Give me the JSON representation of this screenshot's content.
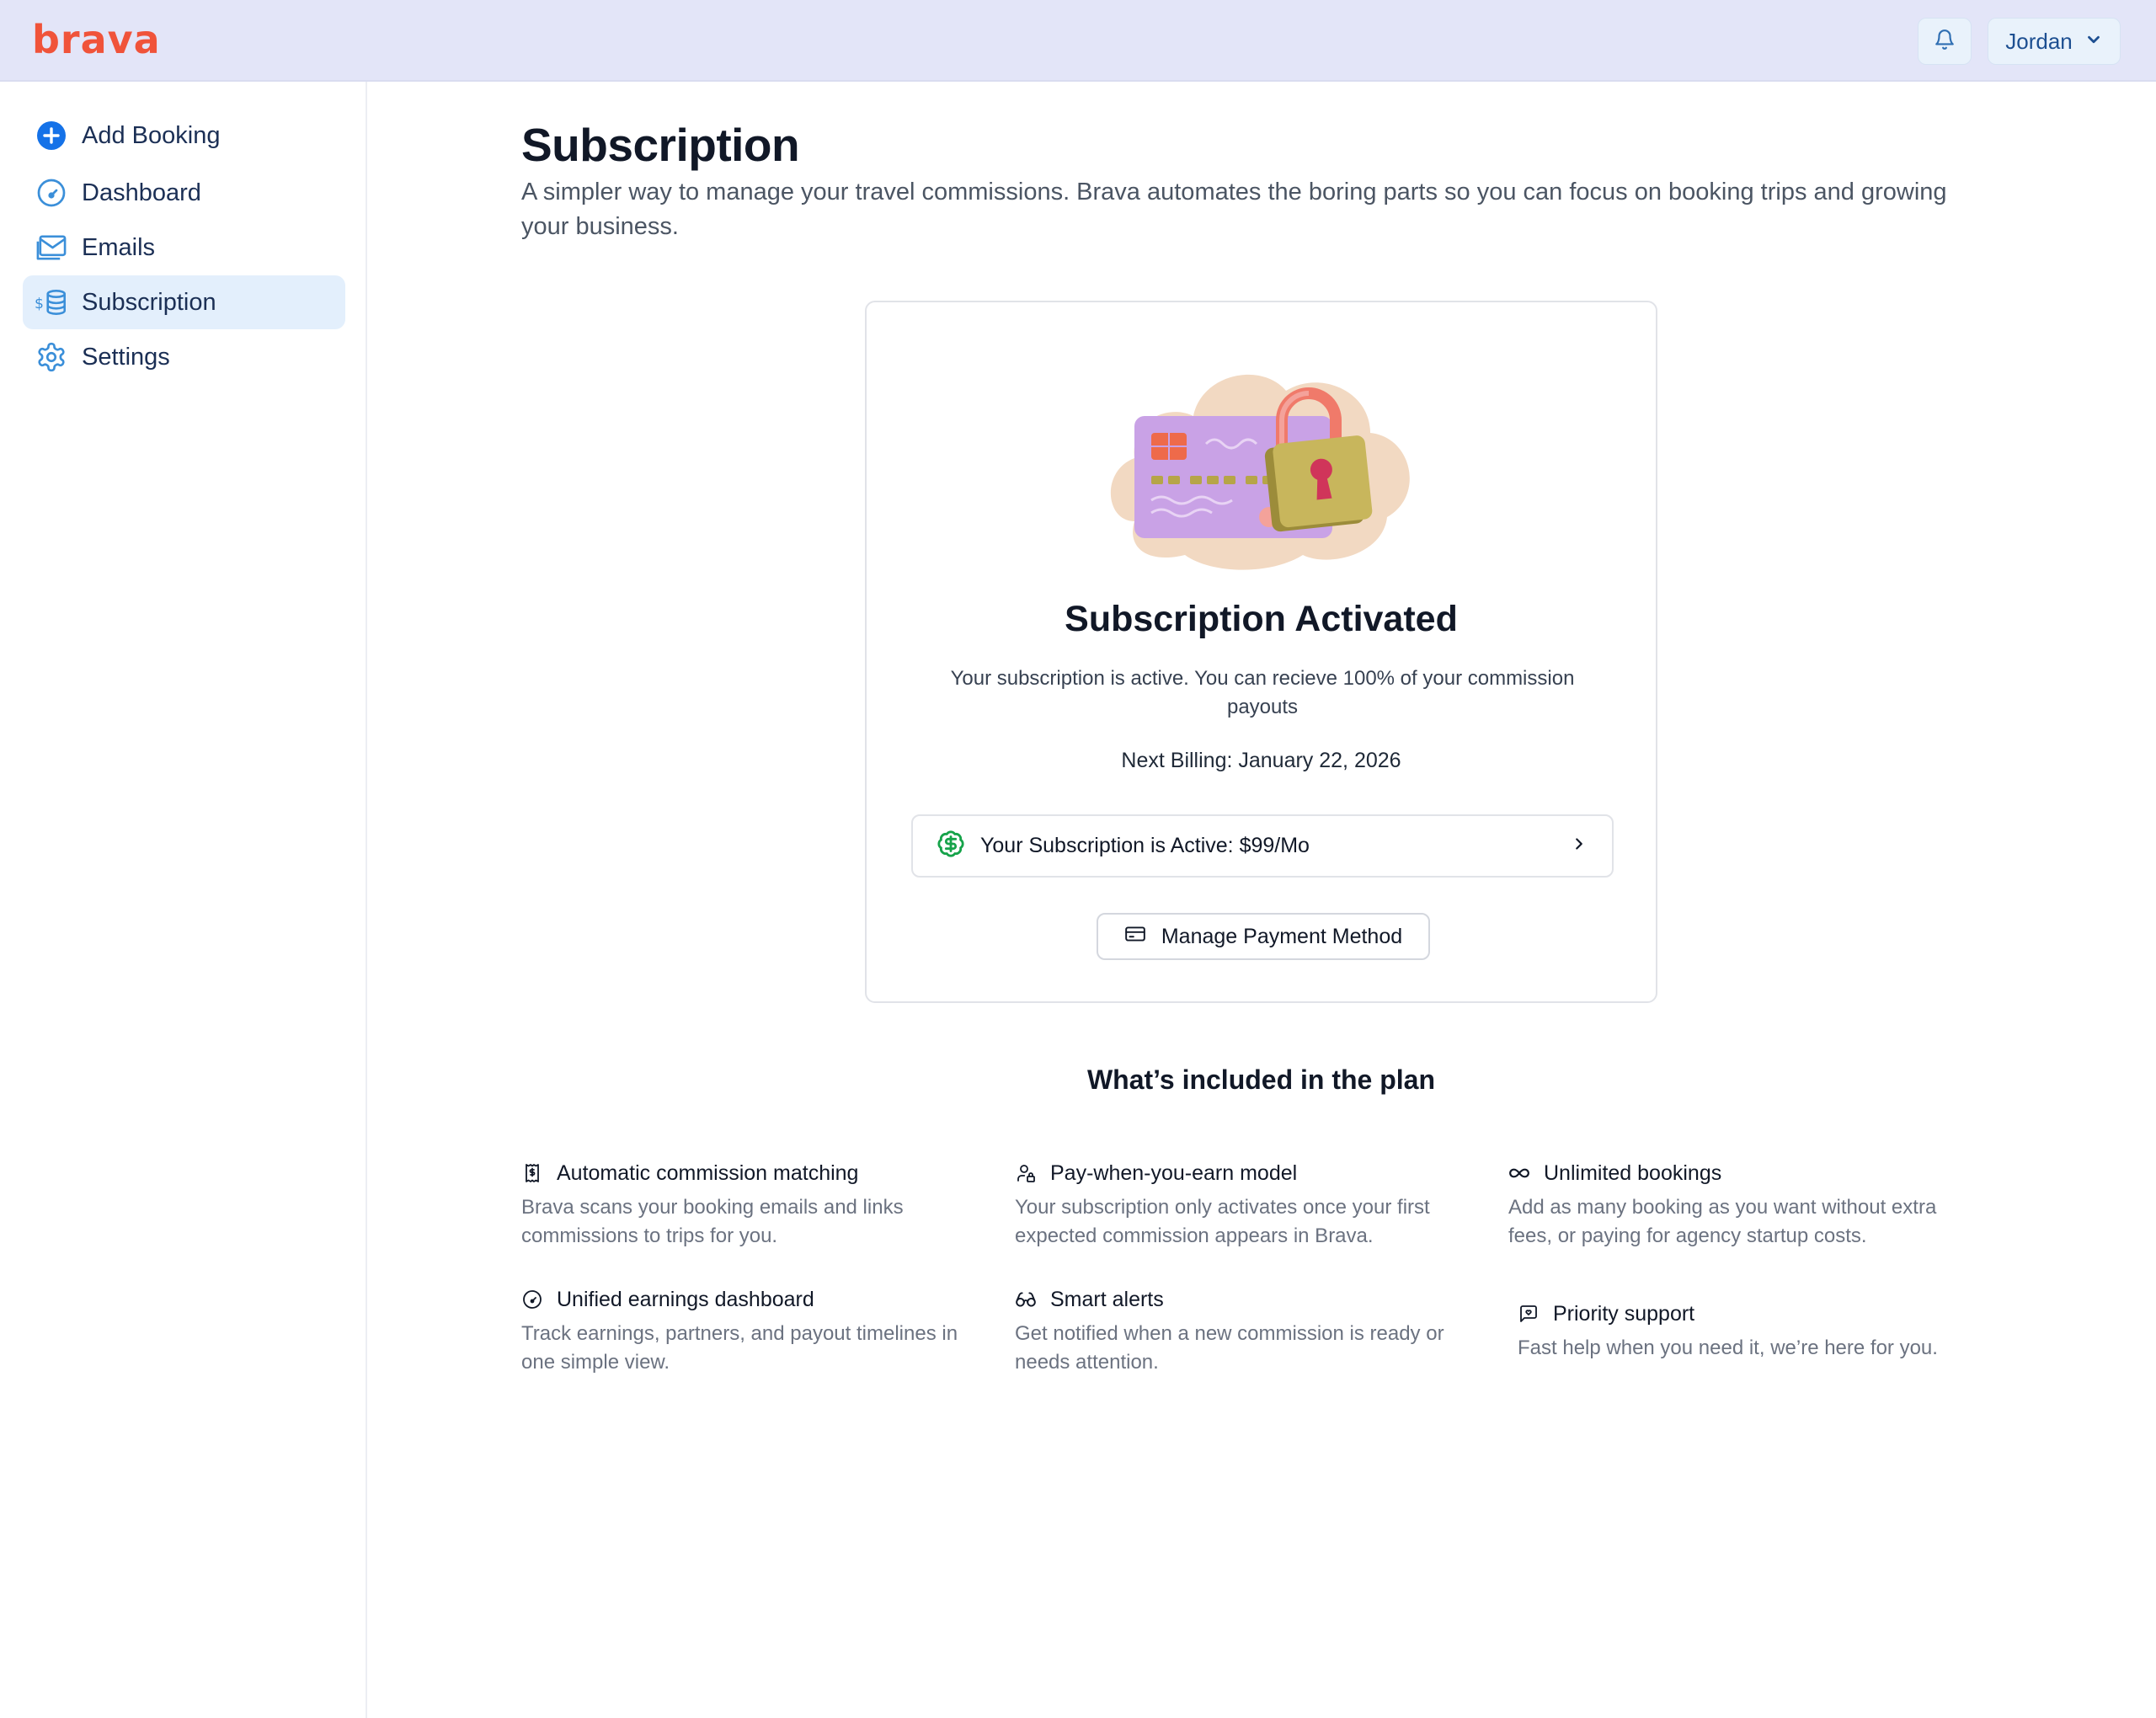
{
  "header": {
    "logo": "brava",
    "user_name": "Jordan"
  },
  "sidebar": {
    "items": [
      {
        "label": "Add Booking",
        "icon": "plus-circle-icon"
      },
      {
        "label": "Dashboard",
        "icon": "gauge-icon"
      },
      {
        "label": "Emails",
        "icon": "mail-icon"
      },
      {
        "label": "Subscription",
        "icon": "coins-icon",
        "active": true
      },
      {
        "label": "Settings",
        "icon": "gear-icon"
      }
    ]
  },
  "main": {
    "title": "Subscription",
    "description": "A simpler way to manage your travel commissions. Brava automates the boring parts so you can focus on booking trips and growing your business.",
    "card": {
      "title": "Subscription Activated",
      "description": "Your subscription is active. You can recieve 100% of your commission payouts",
      "billing": "Next Billing: January 22, 2026",
      "active_label": "Your Subscription is Active: $99/Mo",
      "manage_label": "Manage Payment Method"
    },
    "included_title": "What’s included in the plan",
    "features": [
      {
        "title": "Automatic commission matching",
        "description": "Brava scans your booking emails and links commissions to trips for you.",
        "icon": "receipt-icon"
      },
      {
        "title": "Pay-when-you-earn model",
        "description": "Your subscription only activates once your first expected commission appears in Brava.",
        "icon": "user-lock-icon"
      },
      {
        "title": "Unlimited bookings",
        "description": "Add as many booking as you want without extra fees, or paying for agency startup costs.",
        "icon": "infinity-icon"
      },
      {
        "title": "Unified earnings dashboard",
        "description": "Track earnings, partners, and payout timelines in one simple view.",
        "icon": "gauge-icon"
      },
      {
        "title": "Smart alerts",
        "description": "Get notified when a new commission is ready or needs attention.",
        "icon": "glasses-icon"
      },
      {
        "title": "Priority support",
        "description": "Fast help when you need it, we’re here for you.",
        "icon": "message-heart-icon"
      }
    ]
  },
  "colors": {
    "brand": "#f0533a",
    "header_bg": "#e3e5f8",
    "nav_active_bg": "#e3effc",
    "nav_icon": "#3b8fd9",
    "success": "#16a34a"
  }
}
